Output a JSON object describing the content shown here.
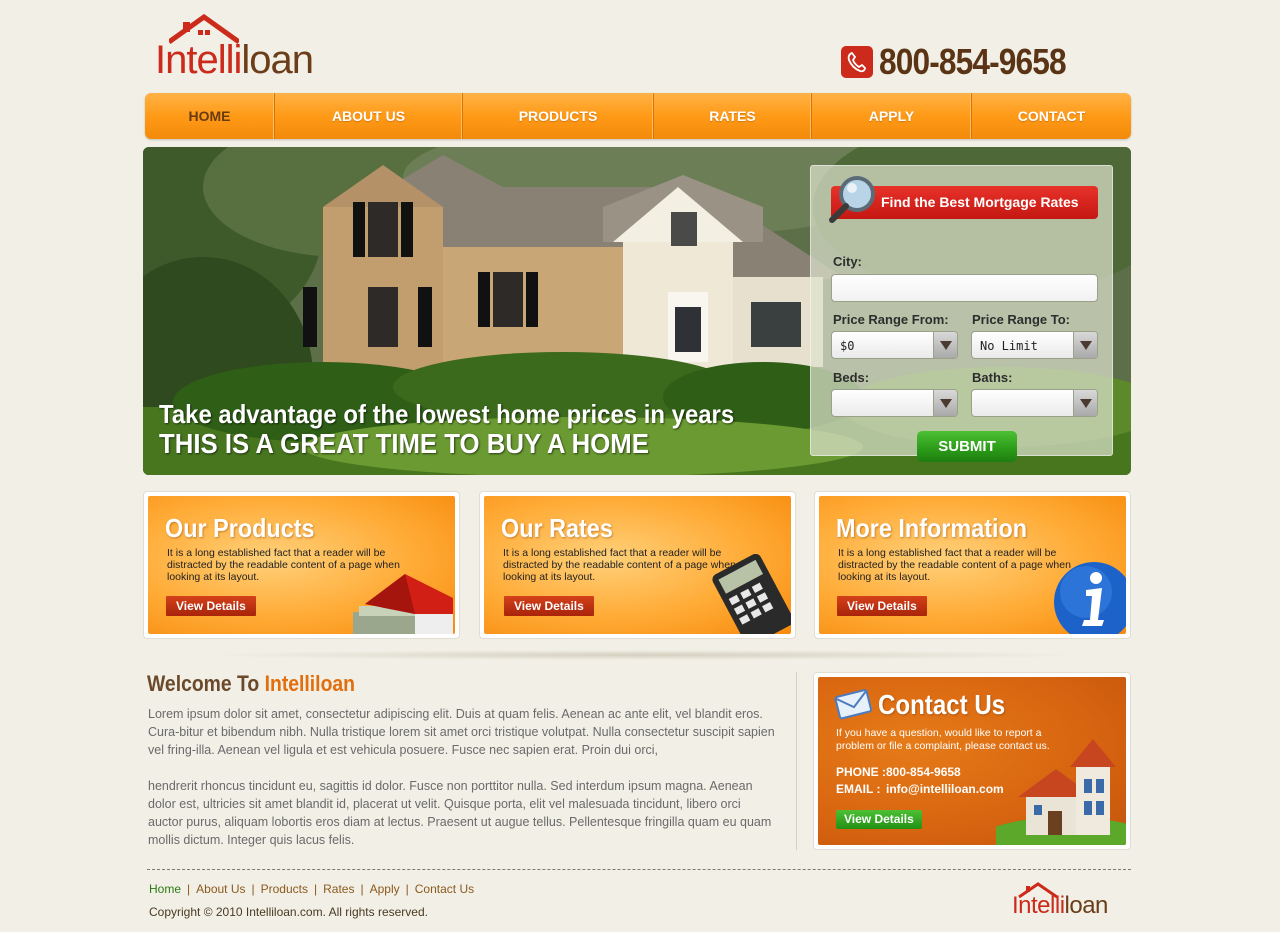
{
  "header": {
    "logo": {
      "part1": "Intelli",
      "part2": "loan"
    },
    "phone": "800-854-9658"
  },
  "nav": {
    "items": [
      {
        "label": "HOME"
      },
      {
        "label": "ABOUT US"
      },
      {
        "label": "PRODUCTS"
      },
      {
        "label": "RATES"
      },
      {
        "label": "APPLY"
      },
      {
        "label": "CONTACT"
      }
    ]
  },
  "hero": {
    "line1": "Take advantage of the lowest home prices in years",
    "line2": "THIS IS A GREAT TIME TO BUY A HOME"
  },
  "search": {
    "title": "Find the Best Mortgage Rates",
    "city_label": "City:",
    "city_value": "",
    "price_from_label": "Price Range From:",
    "price_from_value": "$0",
    "price_to_label": "Price Range To:",
    "price_to_value": "No Limit",
    "beds_label": "Beds:",
    "beds_value": "",
    "baths_label": "Baths:",
    "baths_value": "",
    "submit_label": "SUBMIT"
  },
  "features": [
    {
      "title": "Our Products",
      "text": "It is a long established fact that a reader will be distracted by the readable content of a page when looking at its layout.",
      "button": "View Details"
    },
    {
      "title": "Our Rates",
      "text": "It is a long established fact that a reader will be distracted by the readable content of a page when looking at its layout.",
      "button": "View Details"
    },
    {
      "title": "More Information",
      "text": "It is a long established fact that a reader will be distracted by the readable content of a page when looking at its layout.",
      "button": "View Details"
    }
  ],
  "welcome": {
    "title_prefix": "Welcome To",
    "title_brand": "Intelliloan",
    "para1": "Lorem ipsum dolor sit amet, consectetur adipiscing elit. Duis at quam felis. Aenean ac ante elit, vel blandit eros. Cura-bitur et bibendum nibh. Nulla tristique lorem sit amet orci tristique volutpat. Nulla consectetur suscipit sapien vel fring-illa. Aenean vel ligula et est vehicula posuere. Fusce nec sapien erat. Proin dui orci,",
    "para2": "hendrerit rhoncus tincidunt eu, sagittis id dolor. Fusce non porttitor nulla. Sed interdum ipsum magna. Aenean dolor est, ultricies sit amet blandit id, placerat ut velit. Quisque porta, elit vel malesuada tincidunt, libero orci auctor purus, aliquam lobortis eros diam at lectus. Praesent ut augue tellus. Pellentesque fringilla quam eu quam mollis dictum. Integer quis lacus felis."
  },
  "contact": {
    "title": "Contact Us",
    "text": "If you have a question, would like to report a problem or file a complaint, please contact us.",
    "phone_label": "PHONE :",
    "phone_value": "800-854-9658",
    "email_label": "EMAIL :",
    "email_value": "info@intelliloan.com",
    "button": "View Details"
  },
  "footer": {
    "links": [
      {
        "label": "Home"
      },
      {
        "label": "About Us"
      },
      {
        "label": "Products"
      },
      {
        "label": "Rates"
      },
      {
        "label": "Apply"
      },
      {
        "label": "Contact Us"
      }
    ],
    "separator": "|",
    "copyright": "Copyright © 2010 Intelliloan.com. All rights reserved.",
    "logo": {
      "part1": "Intelli",
      "part2": "loan"
    }
  },
  "colors": {
    "accent_orange": "#ff9a17",
    "brand_red": "#cc2a1a",
    "brand_brown": "#6b3d18",
    "green": "#2a9a18"
  }
}
